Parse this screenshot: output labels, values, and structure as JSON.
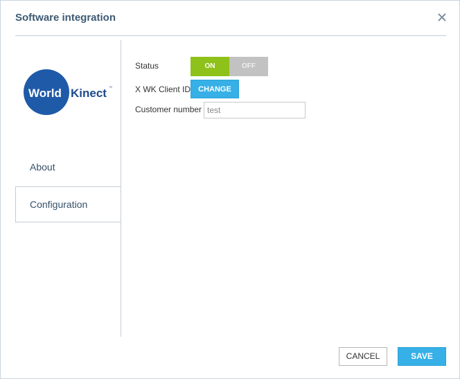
{
  "dialog": {
    "title": "Software integration",
    "close_icon": "close-icon"
  },
  "logo": {
    "word1": "World",
    "word2": "Kinect",
    "trademark": "™",
    "colors": {
      "circle": "#1f5aa8",
      "text_dark": "#1d4a8c"
    }
  },
  "nav": {
    "items": [
      {
        "label": "About",
        "active": false
      },
      {
        "label": "Configuration",
        "active": true
      }
    ]
  },
  "form": {
    "status_label": "Status",
    "status_on": "ON",
    "status_off": "OFF",
    "status_value": "ON",
    "client_id_label": "X WK Client ID",
    "change_label": "CHANGE",
    "customer_number_label": "Customer number",
    "customer_number_value": "test"
  },
  "footer": {
    "cancel_label": "CANCEL",
    "save_label": "SAVE"
  },
  "colors": {
    "accent_blue": "#36b0e6",
    "toggle_on_green": "#8ec11a",
    "toggle_off_gray": "#c2c2c2",
    "title_text": "#3d5a73"
  }
}
